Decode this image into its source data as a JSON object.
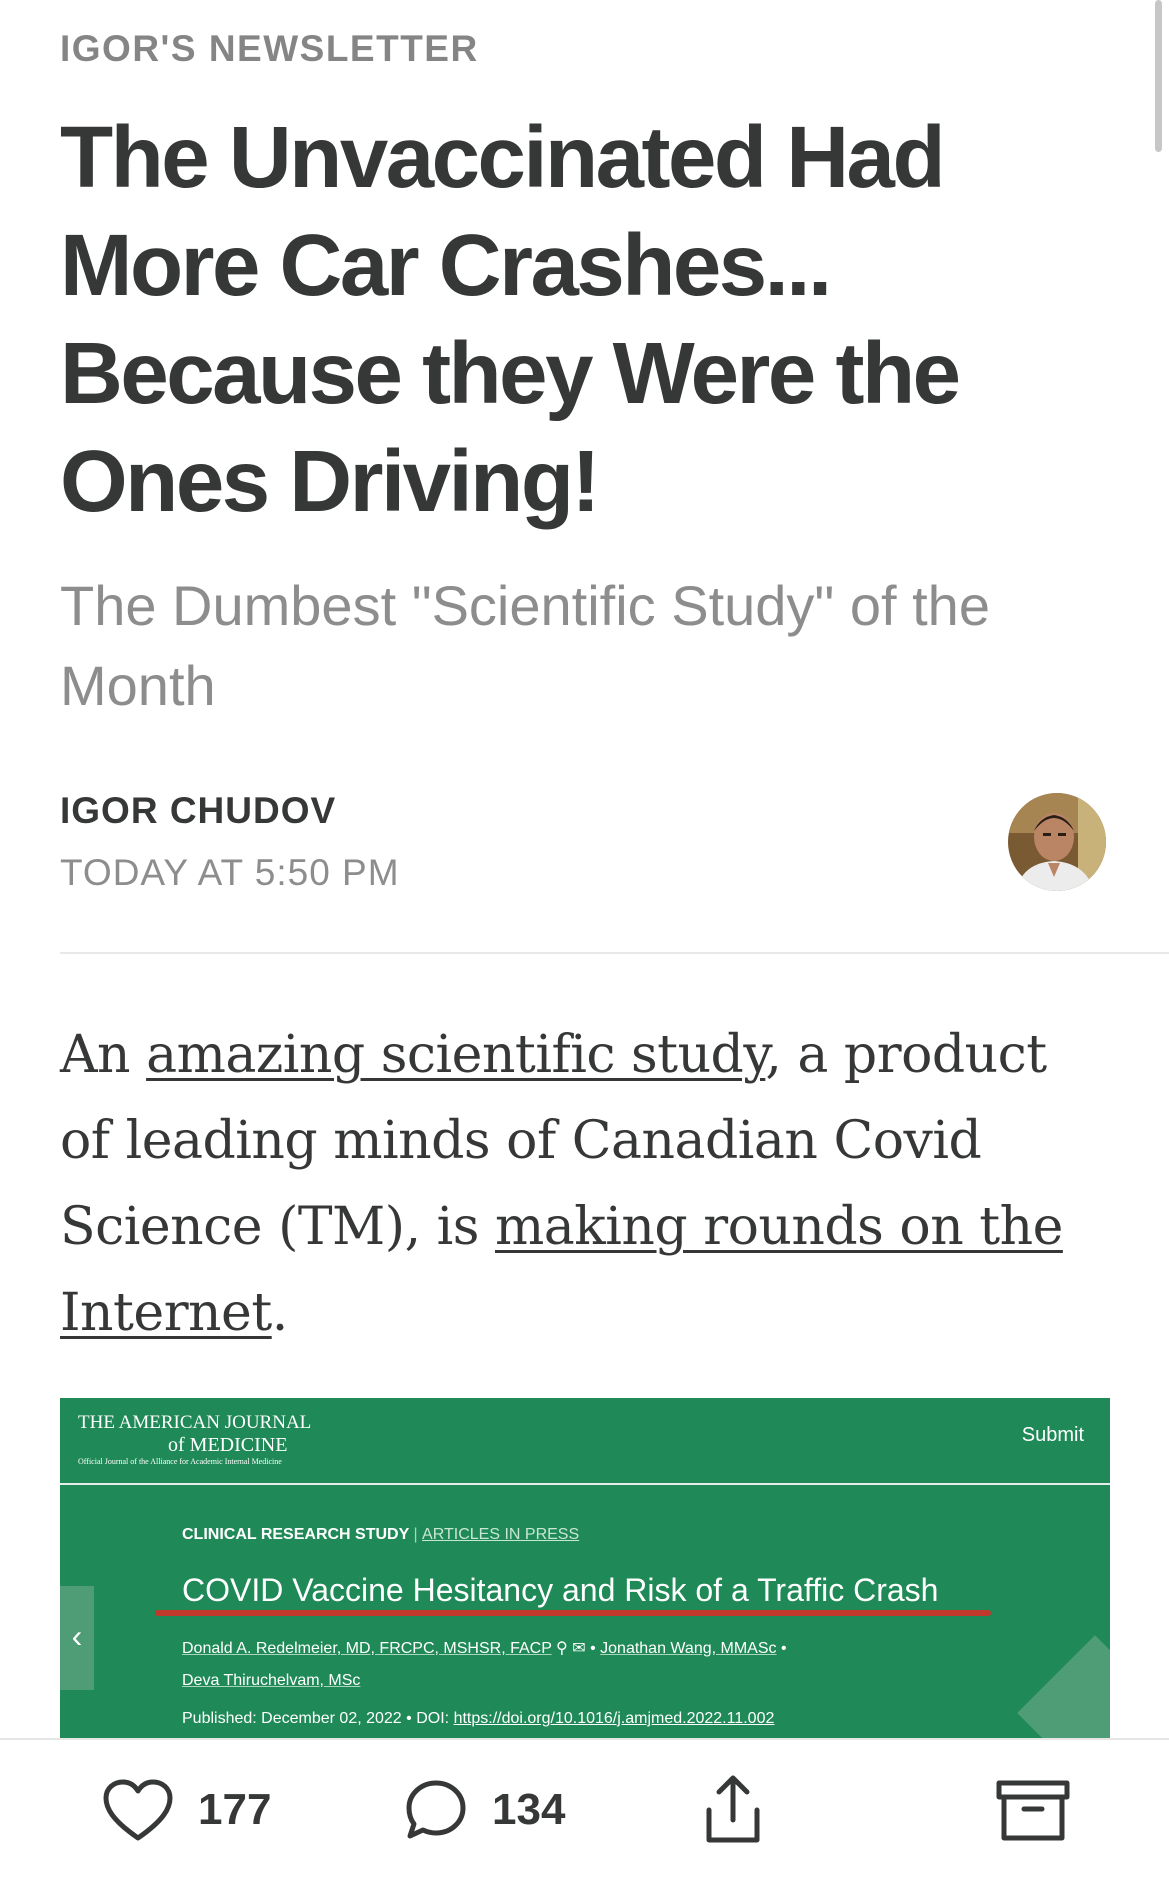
{
  "header": {
    "newsletter_name": "IGOR'S NEWSLETTER"
  },
  "article": {
    "title": "The Unvaccinated Had More Car Crashes... Because they Were the Ones Driving!",
    "subtitle": "The Dumbest \"Scientific Study\" of the Month",
    "author": "IGOR CHUDOV",
    "published": "TODAY AT 5:50 PM",
    "body": {
      "p1": "An ",
      "link1": "amazing scientific study",
      "p2": ", a product of leading minds of Canadian Covid Science (TM), is ",
      "link2": "making rounds on the Internet",
      "p3": "."
    }
  },
  "embed": {
    "journal_line1": "THE AMERICAN JOURNAL",
    "journal_line2": "of MEDICINE",
    "journal_sub": "Official Journal of the Alliance for Academic Internal Medicine",
    "submit": "Submit",
    "study_type": "CLINICAL RESEARCH STUDY",
    "separator": "|",
    "articles_in_press": "ARTICLES IN PRESS",
    "study_title": "COVID Vaccine Hesitancy and Risk of a Traffic Crash",
    "author1": "Donald A. Redelmeier, MD, FRCPC, MSHSR, FACP",
    "author2": "Jonathan Wang, MMASc",
    "author3": "Deva Thiruchelvam, MSc",
    "published_label": "Published: December 02, 2022",
    "doi_label": "DOI:",
    "doi_url": "https://doi.org/10.1016/j.amjmed.2022.11.002",
    "accent_color": "#1f8a57",
    "highlight_color": "#c0392b"
  },
  "bottom_bar": {
    "likes": "177",
    "comments": "134",
    "icons": [
      "heart-icon",
      "comment-icon",
      "share-icon",
      "archive-icon"
    ]
  }
}
